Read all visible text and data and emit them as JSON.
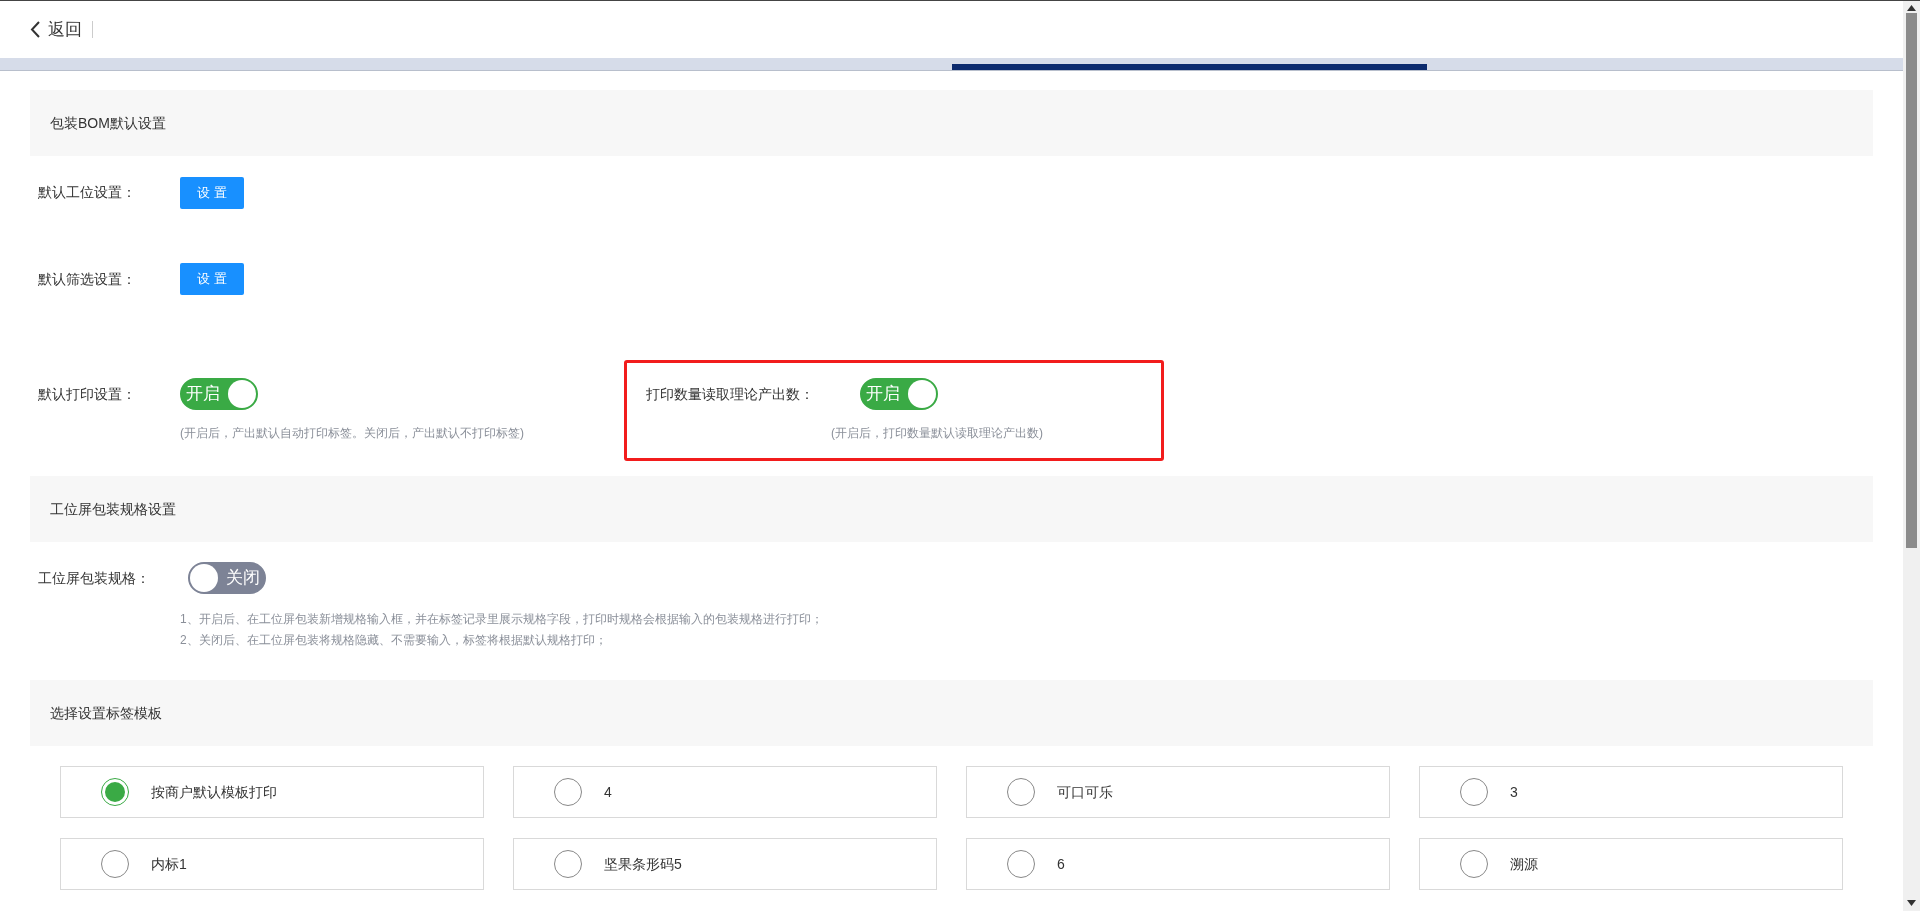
{
  "header": {
    "back_label": "返回"
  },
  "sections": [
    {
      "title": "包装BOM默认设置",
      "items": [
        {
          "kind": "button",
          "label": "默认工位设置：",
          "button": "设 置"
        },
        {
          "kind": "button",
          "label": "默认筛选设置：",
          "button": "设 置"
        },
        {
          "kind": "toggles",
          "toggles": [
            {
              "label": "默认打印设置：",
              "on": true,
              "state_text": "开启",
              "hint": "(开启后，产出默认自动打印标签。关闭后，产出默认不打印标签)",
              "highlighted": false
            },
            {
              "label": "打印数量读取理论产出数：",
              "on": true,
              "state_text": "开启",
              "hint": "(开启后，打印数量默认读取理论产出数)",
              "highlighted": true
            }
          ]
        }
      ]
    },
    {
      "title": "工位屏包装规格设置",
      "items": [
        {
          "kind": "toggle",
          "label": "工位屏包装规格：",
          "on": false,
          "state_text": "关闭",
          "hints": [
            "1、开启后、在工位屏包装新增规格输入框，并在标签记录里展示规格字段，打印时规格会根据输入的包装规格进行打印；",
            "2、关闭后、在工位屏包装将规格隐藏、不需要输入，标签将根据默认规格打印；"
          ]
        }
      ]
    },
    {
      "title": "选择设置标签模板",
      "items": [
        {
          "kind": "radios",
          "options": [
            {
              "label": "按商户默认模板打印",
              "selected": true
            },
            {
              "label": "4",
              "selected": false
            },
            {
              "label": "可口可乐",
              "selected": false
            },
            {
              "label": "3",
              "selected": false
            },
            {
              "label": "内标1",
              "selected": false
            },
            {
              "label": "坚果条形码5",
              "selected": false
            },
            {
              "label": "6",
              "selected": false
            },
            {
              "label": "溯源",
              "selected": false
            }
          ]
        }
      ]
    }
  ]
}
